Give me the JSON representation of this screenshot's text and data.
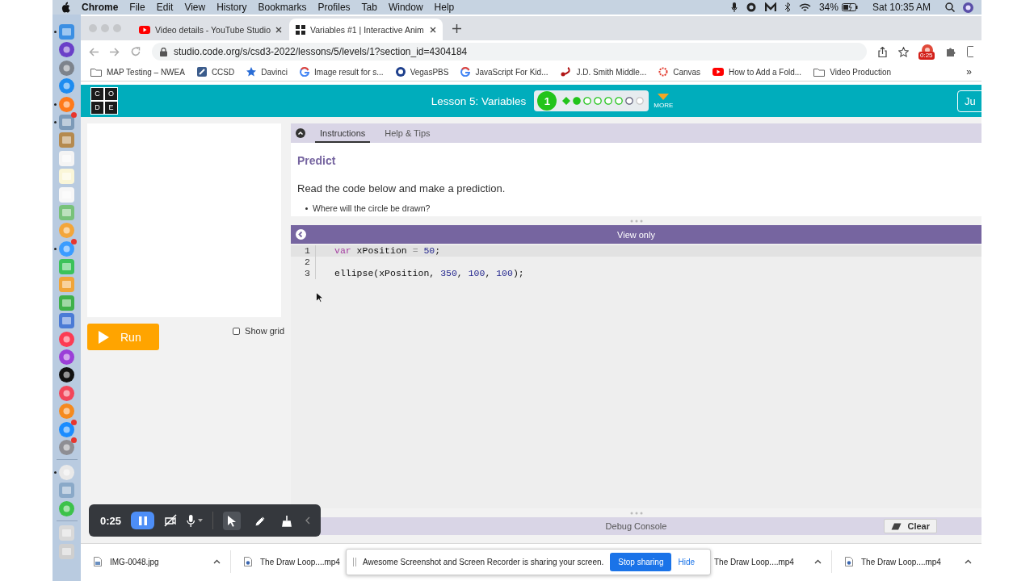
{
  "menubar": {
    "app": "Chrome",
    "menus": [
      "File",
      "Edit",
      "View",
      "History",
      "Bookmarks",
      "Profiles",
      "Tab",
      "Window",
      "Help"
    ],
    "battery": "34%",
    "clock": "Sat 10:35 AM"
  },
  "dock": {
    "apps": [
      {
        "kind": "square",
        "color": "#3b8fe3",
        "running": true,
        "badge": false
      },
      {
        "kind": "round",
        "color": "#6a3fc8",
        "running": false,
        "badge": false
      },
      {
        "kind": "round",
        "color": "#7d838c",
        "running": false,
        "badge": false
      },
      {
        "kind": "round",
        "color": "#1e8cf0",
        "running": false,
        "badge": false
      },
      {
        "kind": "round",
        "color": "#ff7a1a",
        "running": true,
        "badge": false
      },
      {
        "kind": "square",
        "color": "#7c9ab8",
        "running": true,
        "badge": true
      },
      {
        "kind": "square",
        "color": "#b58a4e",
        "running": false,
        "badge": false
      },
      {
        "kind": "square",
        "color": "#f4f4f4",
        "running": false,
        "badge": false
      },
      {
        "kind": "square",
        "color": "#faf6d8",
        "running": false,
        "badge": false
      },
      {
        "kind": "square",
        "color": "#f7f7f7",
        "running": false,
        "badge": false
      },
      {
        "kind": "square",
        "color": "#78c27a",
        "running": false,
        "badge": false
      },
      {
        "kind": "round",
        "color": "#f3a63a",
        "running": false,
        "badge": false
      },
      {
        "kind": "round",
        "color": "#3a9cff",
        "running": true,
        "badge": true
      },
      {
        "kind": "square",
        "color": "#3cc25a",
        "running": false,
        "badge": false
      },
      {
        "kind": "square",
        "color": "#f0a53a",
        "running": false,
        "badge": false
      },
      {
        "kind": "square",
        "color": "#3fb14a",
        "running": false,
        "badge": false
      },
      {
        "kind": "square",
        "color": "#4b7bd6",
        "running": false,
        "badge": false
      },
      {
        "kind": "round",
        "color": "#fc3c54",
        "running": false,
        "badge": false
      },
      {
        "kind": "round",
        "color": "#9b3fd8",
        "running": false,
        "badge": false
      },
      {
        "kind": "round",
        "color": "#111111",
        "running": false,
        "badge": false
      },
      {
        "kind": "round",
        "color": "#f2465a",
        "running": false,
        "badge": false
      },
      {
        "kind": "round",
        "color": "#f58a1f",
        "running": false,
        "badge": false
      },
      {
        "kind": "round",
        "color": "#1a8cff",
        "running": false,
        "badge": true
      },
      {
        "kind": "round",
        "color": "#8e8e93",
        "running": false,
        "badge": true
      },
      {
        "kind": "round",
        "color": "#e9e9e9",
        "running": true,
        "badge": false
      },
      {
        "kind": "square",
        "color": "#8aa9c8",
        "running": false,
        "badge": false
      },
      {
        "kind": "round",
        "color": "#3cc24a",
        "running": false,
        "badge": false
      },
      {
        "kind": "square",
        "color": "#d9d9d9",
        "running": false,
        "badge": false
      },
      {
        "kind": "square",
        "color": "#cfcfcf",
        "running": false,
        "badge": false
      }
    ]
  },
  "browser": {
    "tabs": [
      {
        "title": "Video details - YouTube Studio",
        "kind": "youtube",
        "selected": false
      },
      {
        "title": "Variables #1 | Interactive Anim",
        "kind": "code",
        "selected": true
      }
    ],
    "url": "studio.code.org/s/csd3-2022/lessons/5/levels/1?section_id=4304184",
    "extension_badge": "0:25",
    "bookmarks": [
      {
        "label": "MAP Testing – NWEA",
        "kind": "folder"
      },
      {
        "label": "CCSD",
        "kind": "site"
      },
      {
        "label": "Davinci",
        "kind": "star"
      },
      {
        "label": "Image result for s...",
        "kind": "google"
      },
      {
        "label": "VegasPBS",
        "kind": "pbs"
      },
      {
        "label": "JavaScript For Kid...",
        "kind": "google"
      },
      {
        "label": "J.D. Smith Middle...",
        "kind": "scorpion"
      },
      {
        "label": "Canvas",
        "kind": "canvas"
      },
      {
        "label": "How to Add a Fold...",
        "kind": "youtube"
      },
      {
        "label": "Video Production",
        "kind": "folder"
      }
    ],
    "more_bookmarks": "»"
  },
  "lesson_header": {
    "logo": [
      "C",
      "O",
      "D",
      "E"
    ],
    "title": "Lesson 5: Variables",
    "level": "1",
    "progress": [
      {
        "kind": "diamond",
        "completed": true,
        "attempted": false,
        "current": false
      },
      {
        "kind": "circle",
        "completed": true,
        "attempted": false,
        "current": false
      },
      {
        "kind": "circle",
        "completed": false,
        "attempted": true,
        "current": false
      },
      {
        "kind": "circle",
        "completed": false,
        "attempted": true,
        "current": false
      },
      {
        "kind": "circle",
        "completed": false,
        "attempted": true,
        "current": false
      },
      {
        "kind": "circle",
        "completed": false,
        "attempted": true,
        "current": false
      },
      {
        "kind": "circle",
        "completed": false,
        "attempted": false,
        "current": true
      },
      {
        "kind": "circle",
        "completed": false,
        "attempted": false,
        "current": false
      }
    ],
    "more": "MORE",
    "right_button": "Ju"
  },
  "workspace": {
    "run": "Run",
    "show_grid": {
      "label": "Show grid",
      "checked": false
    },
    "instruction_tabs": [
      {
        "label": "Instructions",
        "selected": true
      },
      {
        "label": "Help & Tips",
        "selected": false
      }
    ],
    "heading": "Predict",
    "text": "Read the code below and make a prediction.",
    "bullets": [
      "Where will the circle be drawn?"
    ],
    "code_bar": "View only",
    "code_lines": [
      {
        "number": "1",
        "highlighted": true,
        "tokens": [
          {
            "kind": "keyword",
            "text": "var "
          },
          {
            "kind": "name",
            "text": "xPosition "
          },
          {
            "kind": "operator",
            "text": "= "
          },
          {
            "kind": "number",
            "text": "50"
          },
          {
            "kind": "punct",
            "text": ";"
          }
        ]
      },
      {
        "number": "2",
        "highlighted": false
      },
      {
        "number": "3",
        "highlighted": false,
        "tokens": [
          {
            "kind": "name",
            "text": "ellipse(xPosition, "
          },
          {
            "kind": "number",
            "text": "350"
          },
          {
            "kind": "punct",
            "text": ", "
          },
          {
            "kind": "number",
            "text": "100"
          },
          {
            "kind": "punct",
            "text": ", "
          },
          {
            "kind": "number",
            "text": "100"
          },
          {
            "kind": "punct",
            "text": ");"
          }
        ]
      }
    ],
    "debug_title": "Debug Console",
    "clear": "Clear"
  },
  "downloads": [
    {
      "name": "IMG-0048.jpg",
      "kind": "image"
    },
    {
      "name": "The Draw Loop....mp4",
      "kind": "video"
    },
    {
      "name": "The Draw Loop....mp4"
    },
    {
      "name": "The Draw Loop....mp4",
      "kind": "video"
    }
  ],
  "recorder": {
    "time": "0:25",
    "tools": [
      {
        "kind": "cursor",
        "selected": true
      },
      {
        "kind": "pen",
        "selected": false
      },
      {
        "kind": "broom",
        "selected": false
      }
    ]
  },
  "share_banner": {
    "text": "Awesome Screenshot and Screen Recorder is sharing your screen.",
    "stop": "Stop sharing",
    "hide": "Hide"
  }
}
